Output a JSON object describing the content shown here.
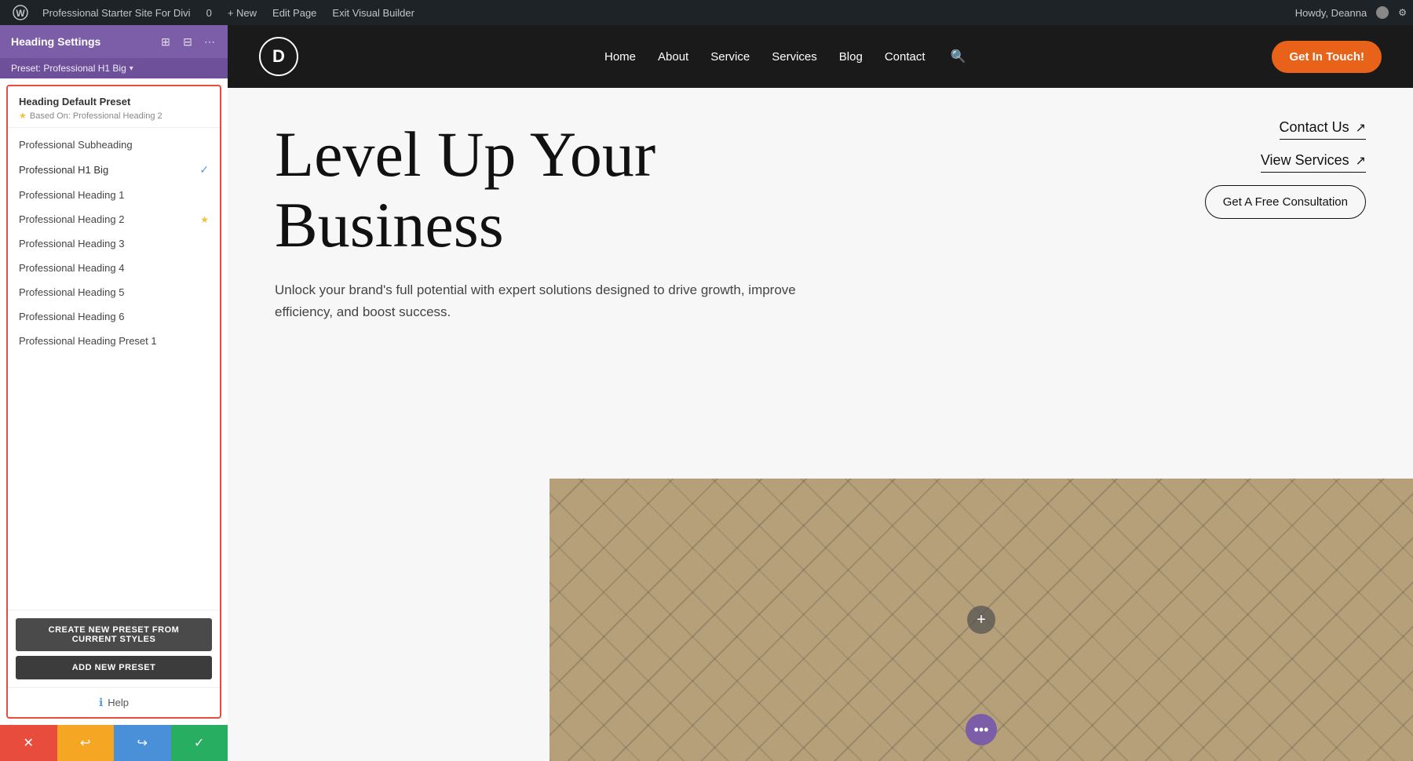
{
  "admin_bar": {
    "wp_label": "WordPress",
    "site_name": "Professional Starter Site For Divi",
    "comments_count": "0",
    "new_label": "+ New",
    "edit_page_label": "Edit Page",
    "exit_builder_label": "Exit Visual Builder",
    "howdy_label": "Howdy, Deanna"
  },
  "panel": {
    "title": "Heading Settings",
    "preset_label": "Preset: Professional H1 Big",
    "expand_icon": "⊞",
    "stack_icon": "⊟",
    "more_icon": "⋯",
    "heading_default_preset_title": "Heading Default Preset",
    "based_on_label": "Based On: Professional Heading 2",
    "presets": [
      {
        "label": "Professional Subheading",
        "active": false,
        "starred": false
      },
      {
        "label": "Professional H1 Big",
        "active": true,
        "starred": false
      },
      {
        "label": "Professional Heading 1",
        "active": false,
        "starred": false
      },
      {
        "label": "Professional Heading 2",
        "active": false,
        "starred": true
      },
      {
        "label": "Professional Heading 3",
        "active": false,
        "starred": false
      },
      {
        "label": "Professional Heading 4",
        "active": false,
        "starred": false
      },
      {
        "label": "Professional Heading 5",
        "active": false,
        "starred": false
      },
      {
        "label": "Professional Heading 6",
        "active": false,
        "starred": false
      },
      {
        "label": "Professional Heading Preset 1",
        "active": false,
        "starred": false
      }
    ],
    "create_btn_label": "CREATE NEW PRESET FROM CURRENT STYLES",
    "add_btn_label": "ADD NEW PRESET",
    "help_label": "Help"
  },
  "bottom_toolbar": {
    "cancel_icon": "✕",
    "undo_icon": "↩",
    "redo_icon": "↪",
    "save_icon": "✓"
  },
  "site_nav": {
    "logo_letter": "D",
    "links": [
      "Home",
      "About",
      "Service",
      "Services",
      "Blog",
      "Contact"
    ],
    "search_icon": "🔍",
    "cta_label": "Get In Touch!"
  },
  "hero": {
    "heading_line1": "Level Up Your",
    "heading_line2": "Business",
    "subtext": "Unlock your brand's full potential with expert solutions designed to drive growth, improve efficiency, and boost success.",
    "cta_contact": "Contact Us",
    "cta_view": "View Services",
    "cta_consultation": "Get A Free Consultation",
    "add_icon": "+",
    "more_icon": "•••"
  }
}
